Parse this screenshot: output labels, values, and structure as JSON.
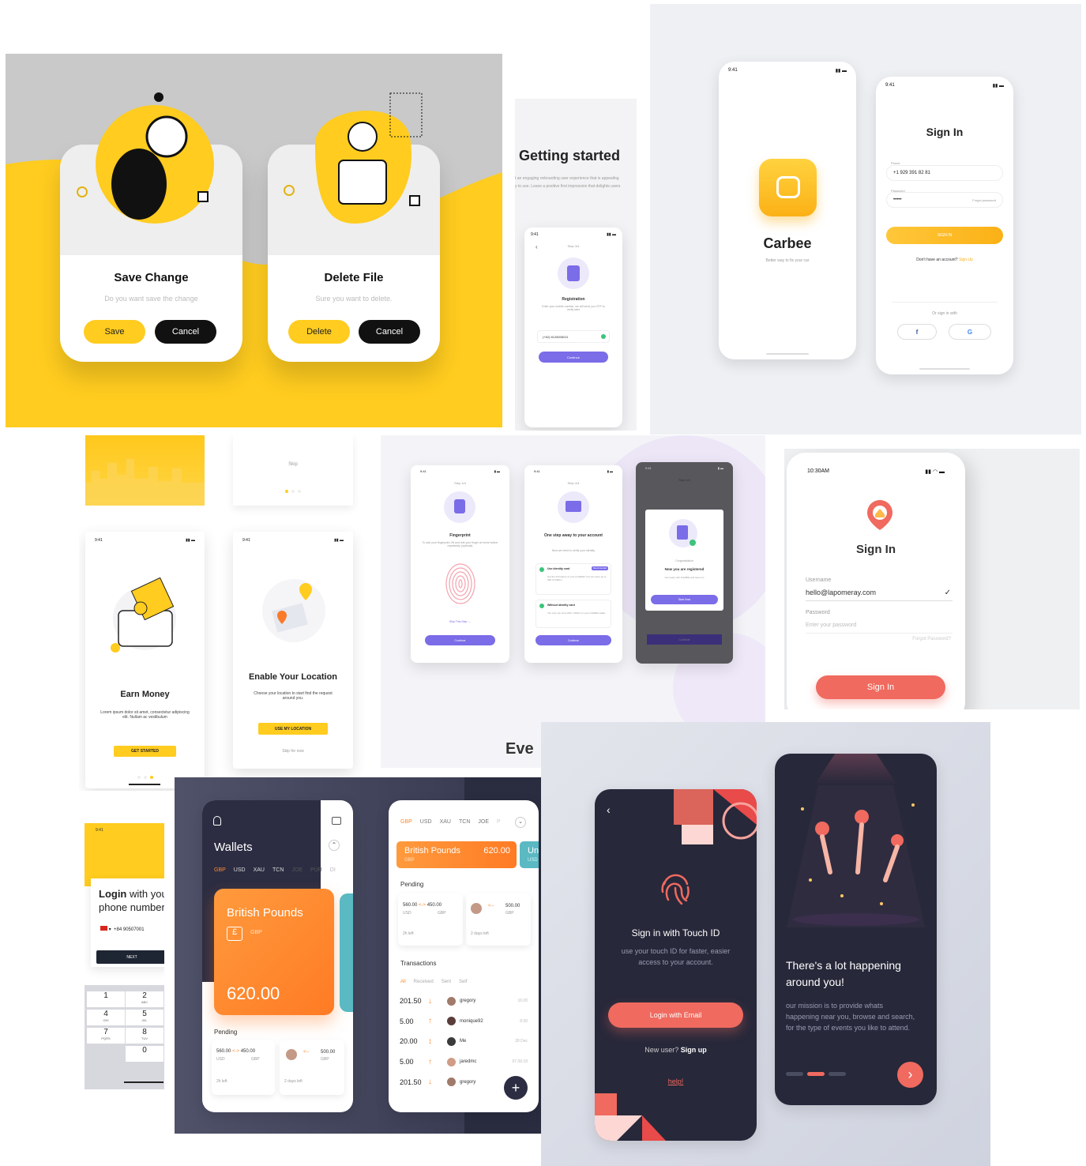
{
  "dialogs": {
    "save": {
      "title": "Save Change",
      "subtitle": "Do you want save the change",
      "primary": "Save",
      "secondary": "Cancel"
    },
    "delete": {
      "title": "Delete File",
      "subtitle": "Sure you want to delete.",
      "primary": "Delete",
      "secondary": "Cancel"
    }
  },
  "getting_started": {
    "heading": "Getting started",
    "desc1": "t an engaging onboarding user experience that is appealing",
    "desc2": "y to use. Leave a positive first impression that delights users",
    "registration": {
      "step": "Step 3/4",
      "title": "Registration",
      "desc": "Enter your mobile number, we will send you OTP to verify later",
      "phone": "(+62) 8128006011",
      "button": "Continue"
    }
  },
  "carbee": {
    "time": "9:41",
    "app_name": "Carbee",
    "tagline": "Better way to fix your car",
    "signin": {
      "title": "Sign In",
      "phone_label": "Phone",
      "phone_value": "+1 929 391 82 81",
      "password_label": "Password",
      "password_value": "•••••",
      "forgot": "Forgot password",
      "button": "SIGN IN",
      "no_account": "Don't have an account?",
      "signup": "Sign Up",
      "or": "Or sign in with",
      "fb": "f",
      "google": "G"
    }
  },
  "onboarding": {
    "time": "9:41",
    "skip": "Skip",
    "earn": {
      "title": "Earn Money",
      "desc": "Lorem ipsum dolor sit amet, consectetur adipiscing elit. Nullam ac vestibulum",
      "button": "GET STARTED"
    },
    "location": {
      "title": "Enable Your Location",
      "desc": "Choose your location to start find the request around you.",
      "button": "USE MY LOCATION",
      "skip": "Skip for now"
    }
  },
  "fingerprint": {
    "time": "9:41",
    "screen1": {
      "step": "Step 4/4",
      "title": "Fingerprint",
      "desc": "To add your fingerprint, lift and rest your finger at home button repeatedly (optional)",
      "skip": "Skip This Step →",
      "button": "Continue"
    },
    "screen2": {
      "step": "Step 4/4",
      "title": "One step away to your account",
      "desc": "Now we need to verify your identity",
      "opt1": "Use identity card",
      "opt1_tag": "Recommended",
      "opt1_desc": "Get the full feature of your IndoBilla! You can store up to IDR 10 Million",
      "opt2": "Without identity card",
      "opt2_desc": "You only can store IDR 1 Million to your IndoBilla wallet",
      "button": "Continue"
    },
    "screen3": {
      "step": "Step 4/4",
      "congrats": "Congratulation",
      "title": "Now you are registered",
      "desc": "Get ready with IndoBilla and have fun",
      "button": "Start Now",
      "bottom": "Continue"
    },
    "footer": "Eve"
  },
  "lapomeray": {
    "time": "10:30AM",
    "title": "Sign In",
    "username_label": "Username",
    "username_value": "hello@lapomeray.com",
    "password_label": "Password",
    "password_placeholder": "Enter your password",
    "forgot": "Forgot Password?",
    "button": "Sign In"
  },
  "login_phone": {
    "time": "9:41",
    "title_bold": "Login",
    "title_rest": " with you",
    "title_line2": "phone number",
    "code": "+84",
    "number": "90507001",
    "button": "NEXT",
    "keys": [
      {
        "d": "1",
        "l": ""
      },
      {
        "d": "2",
        "l": "ABC"
      },
      {
        "d": "4",
        "l": "GHI"
      },
      {
        "d": "5",
        "l": "JKL"
      },
      {
        "d": "7",
        "l": "PQRS"
      },
      {
        "d": "8",
        "l": "TUV"
      },
      {
        "d": "",
        "l": ""
      },
      {
        "d": "0",
        "l": ""
      }
    ]
  },
  "wallets": {
    "title": "Wallets",
    "tabs": [
      "GBP",
      "USD",
      "XAU",
      "TCN",
      "JOE",
      "PUR",
      "DI"
    ],
    "card": {
      "name": "British Pounds",
      "symbol": "£",
      "code": "GBP",
      "amount": "620.00"
    },
    "pending_label": "Pending",
    "pending": [
      {
        "from": "560.00",
        "from_cur": "USD",
        "to": "450.00",
        "to_cur": "GBP",
        "time": "2h left"
      },
      {
        "to": "500.00",
        "to_cur": "GBP",
        "time": "2 days left"
      }
    ]
  },
  "wallet_detail": {
    "tabs": [
      "GBP",
      "USD",
      "XAU",
      "TCN",
      "JOE",
      "P"
    ],
    "card": {
      "name": "British Pounds",
      "code": "GBP",
      "amount": "620.00",
      "next": "Un",
      "next_code": "USD"
    },
    "pending_label": "Pending",
    "pending": [
      {
        "from": "560.00",
        "from_cur": "USD",
        "to": "450.00",
        "to_cur": "GBP",
        "time": "2h left"
      },
      {
        "to": "500.00",
        "to_cur": "GBP",
        "time": "2 days left"
      }
    ],
    "transactions_label": "Transactions",
    "filters": [
      "All",
      "Received",
      "Sent",
      "Self"
    ],
    "rows": [
      {
        "amount": "201.50",
        "dir": "↓",
        "user": "gregory",
        "time": "16:20"
      },
      {
        "amount": "5.00",
        "dir": "↑",
        "user": "monique92",
        "time": "8:30"
      },
      {
        "amount": "20.00",
        "dir": "↕",
        "user": "Me",
        "time": "28 Dec"
      },
      {
        "amount": "5.00",
        "dir": "↑",
        "user": "jaredmc",
        "time": "07.09.18"
      },
      {
        "amount": "201.50",
        "dir": "↓",
        "user": "gregory",
        "time": ""
      }
    ],
    "fab": "+"
  },
  "touchid": {
    "title": "Sign in with Touch ID",
    "desc": "use your touch ID for faster, easier access to your account.",
    "button": "Login with Email",
    "new_user": "New user?",
    "signup": "Sign up",
    "help": "help!"
  },
  "events": {
    "title": "There's a lot happening around you!",
    "desc": "our mission is to provide whats happening near you, browse and search, for the type of events you like to attend.",
    "next": "›"
  },
  "colors": {
    "yellow": "#ffcc1f",
    "carbee_yellow": "#fbbf24",
    "purple": "#7b6ce8",
    "coral": "#f06a5f",
    "orange": "#ff8a2c",
    "dark": "#27283a"
  }
}
